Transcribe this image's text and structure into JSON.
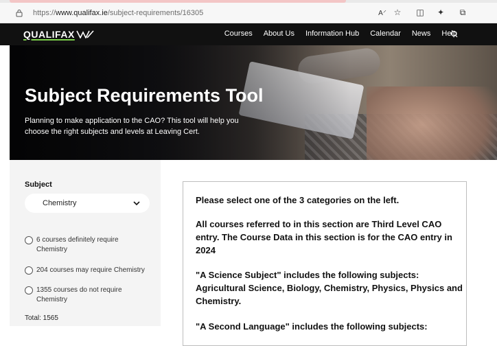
{
  "browser": {
    "url_scheme": "https://",
    "url_host": "www.qualifax.ie",
    "url_path": "/subject-requirements/16305"
  },
  "site": {
    "logo_text": "QUALIFAX",
    "nav": [
      "Courses",
      "About Us",
      "Information Hub",
      "Calendar",
      "News",
      "Help"
    ]
  },
  "hero": {
    "title": "Subject Requirements Tool",
    "subtitle": "Planning to make application to the CAO? This tool will help you choose the right subjects and levels at Leaving Cert."
  },
  "sidebar": {
    "subject_label": "Subject",
    "selected_subject": "Chemistry",
    "options": [
      "6 courses definitely require Chemistry",
      "204 courses may require Chemistry",
      "1355 courses do not require Chemistry"
    ],
    "total": "Total: 1565"
  },
  "content": {
    "p1": "Please select one of the 3 categories on the left.",
    "p2": "All courses referred to in this section are Third Level CAO entry. The Course Data in this section is for the CAO entry in 2024",
    "p3": "\"A Science Subject\" includes the following subjects: Agricultural Science, Biology, Chemistry, Physics, Physics and Chemistry.",
    "p4": "\"A Second Language\" includes the following subjects:"
  },
  "colors": {
    "nav_bg": "#111111",
    "logo_accent": "#7bd14b",
    "sidebar_bg": "#f4f4f4"
  }
}
